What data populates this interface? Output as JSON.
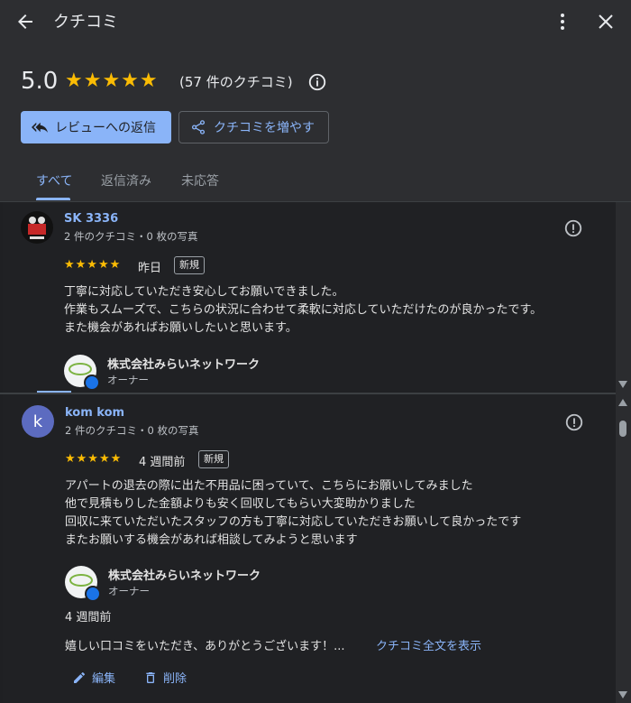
{
  "header": {
    "title": "クチコミ",
    "rating": "5.0",
    "stars": "★★★★★",
    "review_count": "(57 件のクチコミ)",
    "reply_button": "レビューへの返信",
    "share_button": "クチコミを増やす",
    "tabs": [
      "すべて",
      "返信済み",
      "未応答"
    ]
  },
  "reviews": [
    {
      "name": "SK 3336",
      "meta": "2 件のクチコミ・0 枚の写真",
      "stars": "★★★★★",
      "date": "昨日",
      "badge": "新規",
      "text": "丁寧に対応していただき安心してお願いできました。\n作業もスムーズで、こちらの状況に合わせて柔軟に対応していただけたのが良かったです。\nまた機会があればお願いしたいと思います。",
      "owner_name": "株式会社みらいネットワーク",
      "owner_role": "オーナー"
    },
    {
      "avatar_letter": "k",
      "name": "kom kom",
      "meta": "2 件のクチコミ・0 枚の写真",
      "stars": "★★★★★",
      "date": "4 週間前",
      "badge": "新規",
      "text": "アパートの退去の際に出た不用品に困っていて、こちらにお願いしてみました\n他で見積もりした金額よりも安く回収してもらい大変助かりました\n回収に来ていただいたスタッフの方も丁寧に対応していただきお願いして良かったです\nまたお願いする機会があれば相談してみようと思います",
      "owner_name": "株式会社みらいネットワーク",
      "owner_role": "オーナー",
      "reply_date": "4 週間前",
      "reply_text": "嬉しい口コミをいただき、ありがとうございます！...",
      "reply_link": "クチコミ全文を表示",
      "edit_label": "編集",
      "delete_label": "削除"
    }
  ],
  "colors": {
    "accent": "#8ab4f8",
    "star": "#fbbc04",
    "background": "#202124",
    "header_bg": "#2d2e31"
  }
}
